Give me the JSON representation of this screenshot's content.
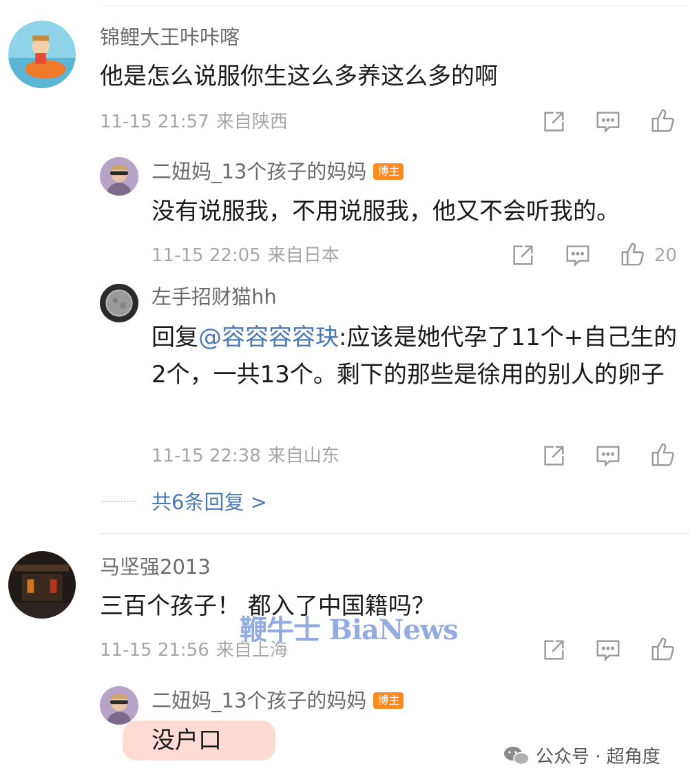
{
  "comments": [
    {
      "author": "锦鲤大王咔咔喀",
      "text": "他是怎么说服你生这么多养这么多的啊",
      "time": "11-15 21:57",
      "location": "来自陕西",
      "replies": [
        {
          "author": "二妞妈_13个孩子的妈妈",
          "badge": "博主",
          "text": "没有说服我，不用说服我，他又不会听我的。",
          "time": "11-15 22:05",
          "location": "来自日本",
          "likes": "20"
        },
        {
          "author": "左手招财猫hh",
          "text_prefix": "回复",
          "mention": "@容容容容玦",
          "text": ":应该是她代孕了11个+自己生的2个，一共13个。剩下的那些是徐用的别人的卵子",
          "time": "11-15 22:38",
          "location": "来自山东"
        }
      ],
      "more_replies": "共6条回复 >"
    },
    {
      "author": "马坚强2013",
      "text": "三百个孩子！ 都入了中国籍吗？",
      "time": "11-15 21:56",
      "location": "来自上海",
      "replies": [
        {
          "author": "二妞妈_13个孩子的妈妈",
          "badge": "博主",
          "text": "没户口"
        }
      ]
    }
  ],
  "icons": {
    "share": "share-icon",
    "comment": "comment-icon",
    "like": "thumbs-up-icon"
  },
  "watermark": "鞭牛士 BiaNews",
  "footer": {
    "wechat_label": "公众号 · 超角度"
  },
  "colors": {
    "badge": "#ff8a1f",
    "mention": "#4a78b8",
    "meta": "#a6a6a6",
    "highlight": "#ffd5cc"
  }
}
